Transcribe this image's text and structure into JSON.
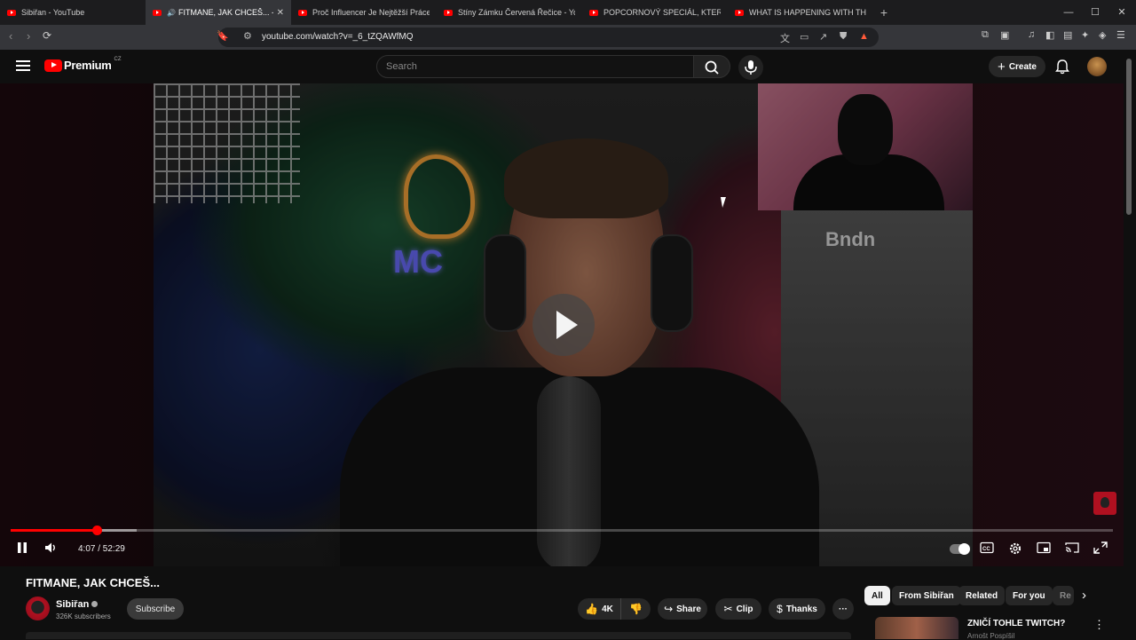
{
  "browser": {
    "tabs": [
      {
        "label": "Sibiřan - YouTube",
        "active": false,
        "audio": false,
        "close": ""
      },
      {
        "label": "FITMANE, JAK CHCEŠ... - YouTube",
        "active": true,
        "audio": true,
        "close": "✕"
      },
      {
        "label": "Proč Influencer Je Nejtěžší Práce? - YouTube",
        "active": false,
        "audio": false,
        "close": ""
      },
      {
        "label": "Stíny Zámku Červená Řečice - YouTube",
        "active": false,
        "audio": false,
        "close": ""
      },
      {
        "label": "POPCORNOVÝ SPECIÁL, KTERÝ JE NEJ...",
        "active": false,
        "audio": false,
        "close": ""
      },
      {
        "label": "WHAT IS HAPPENING WITH THE USA",
        "active": false,
        "audio": false,
        "close": ""
      }
    ],
    "new_tab": "+",
    "url": "youtube.com/watch?v=_6_tZQAWfMQ",
    "window_controls": {
      "minimize": "—",
      "maximize": "☐",
      "close": "✕"
    }
  },
  "youtube": {
    "logo_text": "Premium",
    "logo_country": "CZ",
    "search_placeholder": "Search",
    "create_label": "Create",
    "accent": "#ff0000"
  },
  "player": {
    "current_time": "4:07",
    "duration": "52:29",
    "time_display": "4:07 / 52:29",
    "progress_fraction": 0.0784,
    "buffered_fraction": 0.114,
    "pip_sign": "Bndn",
    "neon_text": "MC"
  },
  "video": {
    "title": "FITMANE, JAK CHCEŠ...",
    "channel_name": "Sibiřan",
    "subscribers": "326K subscribers",
    "subscribe_label": "Subscribe",
    "likes": "4K",
    "share_label": "Share",
    "clip_label": "Clip",
    "thanks_label": "Thanks",
    "more": "···"
  },
  "filters": {
    "chips": [
      "All",
      "From Sibiřan",
      "Related",
      "For you",
      "Re"
    ],
    "active": "All"
  },
  "related": [
    {
      "title": "ZNIČÍ TOHLE TWITCH?",
      "channel": "Arnošt Pospíšil"
    }
  ]
}
